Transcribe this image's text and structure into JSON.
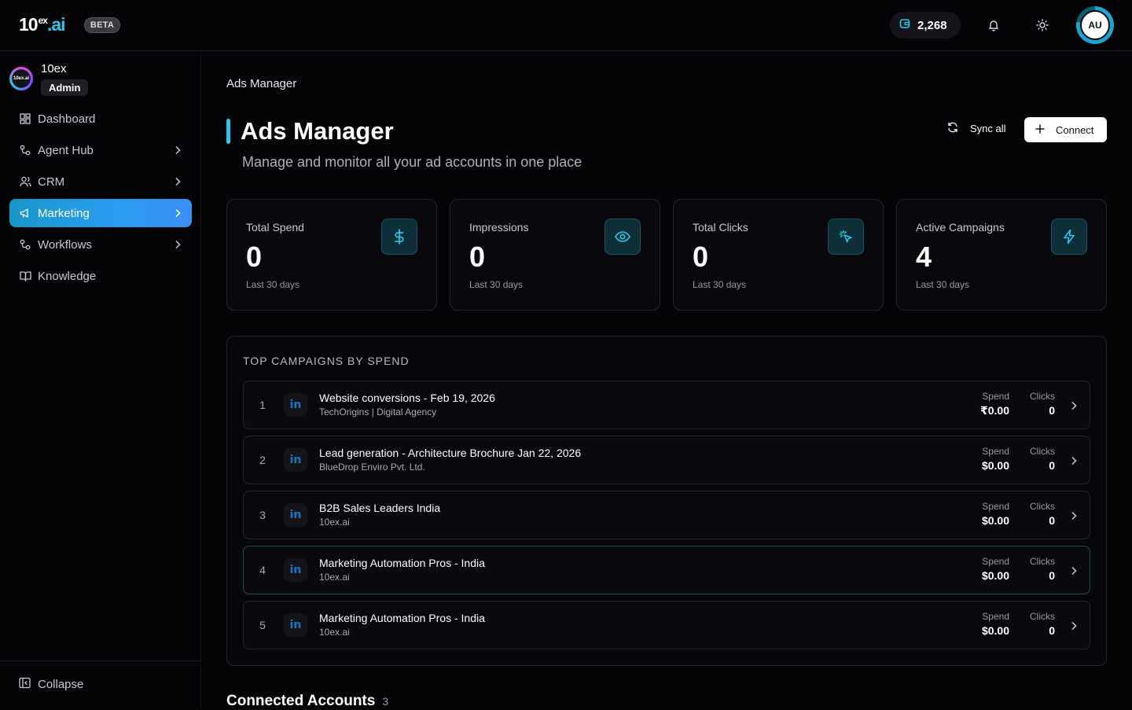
{
  "brand": {
    "logo_main": "10",
    "logo_sup": "ex",
    "logo_suffix": ".ai",
    "beta": "BETA"
  },
  "header": {
    "credits": "2,268",
    "avatar_initials": "AU"
  },
  "org": {
    "logo_text": "10ex.ai",
    "name": "10ex",
    "role": "Admin"
  },
  "sidebar": {
    "items": [
      {
        "label": "Dashboard"
      },
      {
        "label": "Agent Hub"
      },
      {
        "label": "CRM"
      },
      {
        "label": "Marketing"
      },
      {
        "label": "Workflows"
      },
      {
        "label": "Knowledge"
      }
    ],
    "collapse": "Collapse"
  },
  "page": {
    "breadcrumb": "Ads Manager",
    "title": "Ads Manager",
    "subtitle": "Manage and monitor all your ad accounts in one place",
    "sync_label": "Sync all",
    "connect_label": "Connect"
  },
  "stats": [
    {
      "label": "Total Spend",
      "value": "0",
      "period": "Last 30 days",
      "icon": "dollar-icon"
    },
    {
      "label": "Impressions",
      "value": "0",
      "period": "Last 30 days",
      "icon": "eye-icon"
    },
    {
      "label": "Total Clicks",
      "value": "0",
      "period": "Last 30 days",
      "icon": "click-icon"
    },
    {
      "label": "Active Campaigns",
      "value": "4",
      "period": "Last 30 days",
      "icon": "bolt-icon"
    }
  ],
  "top_campaigns": {
    "title": "TOP CAMPAIGNS BY SPEND",
    "spend_label": "Spend",
    "clicks_label": "Clicks",
    "platform_glyph": "in",
    "rows": [
      {
        "rank": "1",
        "name": "Website conversions - Feb 19, 2026",
        "account": "TechOrigins | Digital Agency",
        "spend": "₹0.00",
        "clicks": "0"
      },
      {
        "rank": "2",
        "name": "Lead generation - Architecture Brochure Jan 22, 2026",
        "account": "BlueDrop Enviro Pvt. Ltd.",
        "spend": "$0.00",
        "clicks": "0"
      },
      {
        "rank": "3",
        "name": "B2B Sales Leaders India",
        "account": "10ex.ai",
        "spend": "$0.00",
        "clicks": "0"
      },
      {
        "rank": "4",
        "name": "Marketing Automation Pros - India",
        "account": "10ex.ai",
        "spend": "$0.00",
        "clicks": "0"
      },
      {
        "rank": "5",
        "name": "Marketing Automation Pros - India",
        "account": "10ex.ai",
        "spend": "$0.00",
        "clicks": "0"
      }
    ]
  },
  "connected_accounts": {
    "title": "Connected Accounts",
    "count": "3"
  },
  "colors": {
    "accent": "#2ec6ea",
    "active_nav": "#2a9df2",
    "linkedin": "#1476c4",
    "background": "#050508"
  }
}
